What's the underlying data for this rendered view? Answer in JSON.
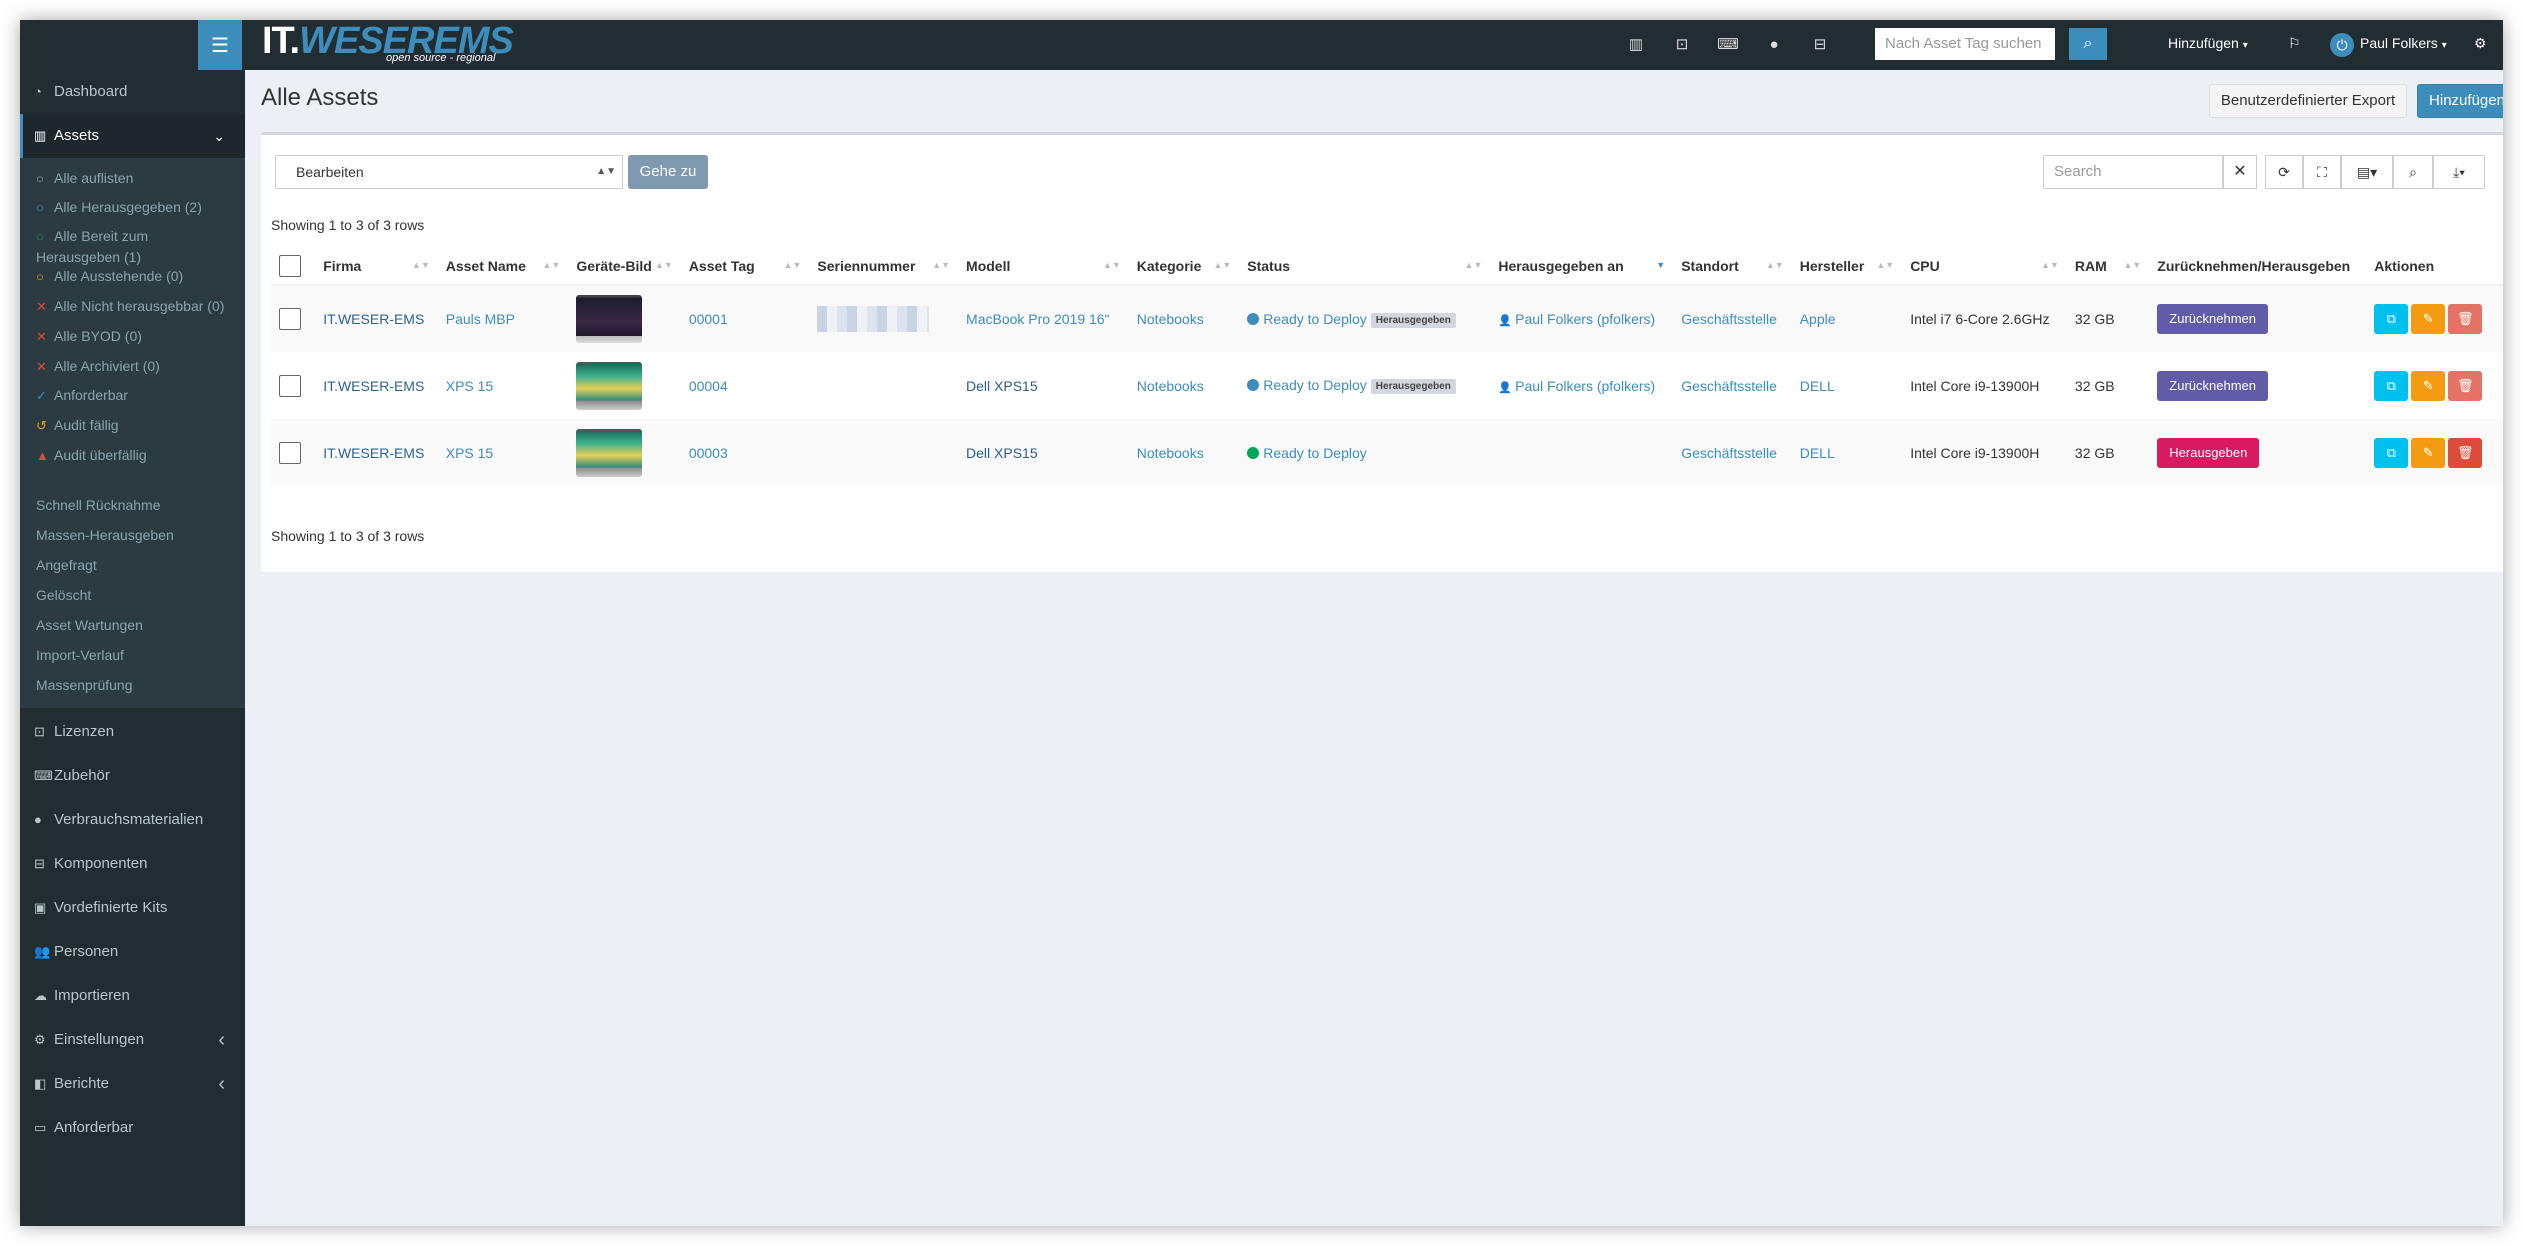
{
  "topbar": {
    "logo_it": "IT.",
    "logo_weser": "WESER",
    "logo_ems": "EMS",
    "logo_tagline": "open source - regional",
    "tag_search_placeholder": "Nach Asset Tag suchen",
    "add_menu": "Hinzufügen",
    "user_name": "Paul Folkers"
  },
  "sidebar": {
    "dashboard": "Dashboard",
    "assets": "Assets",
    "sub_items": [
      {
        "label": "Alle auflisten",
        "icon": "○",
        "color": "#8aa4af"
      },
      {
        "label": "Alle Herausgegeben (2)",
        "icon": "○",
        "color": "#3c8dbc"
      },
      {
        "label": "Alle Bereit zum",
        "label2": "Herausgeben (1)",
        "icon": "○",
        "color": "#00a65a"
      },
      {
        "label": "Alle Ausstehende (0)",
        "icon": "○",
        "color": "#f39c12"
      },
      {
        "label": "Alle Nicht herausgebbar (0)",
        "icon": "✕",
        "color": "#dd4b39"
      },
      {
        "label": "Alle BYOD (0)",
        "icon": "✕",
        "color": "#dd4b39"
      },
      {
        "label": "Alle Archiviert (0)",
        "icon": "✕",
        "color": "#dd4b39"
      },
      {
        "label": "Anforderbar",
        "icon": "✓",
        "color": "#3c8dbc"
      },
      {
        "label": "Audit fällig",
        "icon": "↺",
        "color": "#f39c12"
      },
      {
        "label": "Audit überfällig",
        "icon": "▲",
        "color": "#dd4b39"
      }
    ],
    "links": [
      "Schnell Rücknahme",
      "Massen-Herausgeben",
      "Angefragt",
      "Gelöscht",
      "Asset Wartungen",
      "Import-Verlauf",
      "Massenprüfung"
    ],
    "main_items": [
      "Lizenzen",
      "Zubehör",
      "Verbrauchsmaterialien",
      "Komponenten",
      "Vordefinierte Kits",
      "Personen",
      "Importieren",
      "Einstellungen",
      "Berichte",
      "Anforderbar"
    ]
  },
  "page": {
    "title": "Alle Assets",
    "export_button": "Benutzerdefinierter Export",
    "add_button": "Hinzufügen"
  },
  "toolbar": {
    "bulk_action": "Bearbeiten",
    "go_button": "Gehe zu",
    "search_placeholder": "Search",
    "rows_info": "Showing 1 to 3 of 3 rows"
  },
  "table": {
    "headers": [
      "Firma",
      "Asset Name",
      "Geräte-Bild",
      "Asset Tag",
      "Seriennummer",
      "Modell",
      "Kategorie",
      "Status",
      "Herausgegeben an",
      "Standort",
      "Hersteller",
      "CPU",
      "RAM",
      "Zurücknehmen/Herausgeben",
      "Aktionen"
    ],
    "rows": [
      {
        "firma": "IT.WESER-EMS",
        "name": "Pauls MBP",
        "image": "mac",
        "tag": "00001",
        "model": "MacBook Pro 2019 16\"",
        "category": "Notebooks",
        "status": "Ready to Deploy",
        "status_color": "#3c8dbc",
        "badge": "Herausgegeben",
        "assigned": "Paul Folkers (pfolkers)",
        "location": "Geschäftsstelle",
        "manufacturer": "Apple",
        "cpu": "Intel i7 6-Core 2.6GHz",
        "ram": "32 GB",
        "checkout": "Zurücknehmen",
        "checkout_color": "#605ca8"
      },
      {
        "firma": "IT.WESER-EMS",
        "name": "XPS 15",
        "image": "xps",
        "tag": "00004",
        "model": "Dell XPS15",
        "category": "Notebooks",
        "status": "Ready to Deploy",
        "status_color": "#3c8dbc",
        "badge": "Herausgegeben",
        "assigned": "Paul Folkers (pfolkers)",
        "location": "Geschäftsstelle",
        "manufacturer": "DELL",
        "cpu": "Intel Core i9-13900H",
        "ram": "32 GB",
        "checkout": "Zurücknehmen",
        "checkout_color": "#605ca8"
      },
      {
        "firma": "IT.WESER-EMS",
        "name": "XPS 15",
        "image": "xps",
        "tag": "00003",
        "model": "Dell XPS15",
        "category": "Notebooks",
        "status": "Ready to Deploy",
        "status_color": "#00a65a",
        "badge": "",
        "assigned": "",
        "location": "Geschäftsstelle",
        "manufacturer": "DELL",
        "cpu": "Intel Core i9-13900H",
        "ram": "32 GB",
        "checkout": "Herausgeben",
        "checkout_color": "#d81b60"
      }
    ]
  }
}
